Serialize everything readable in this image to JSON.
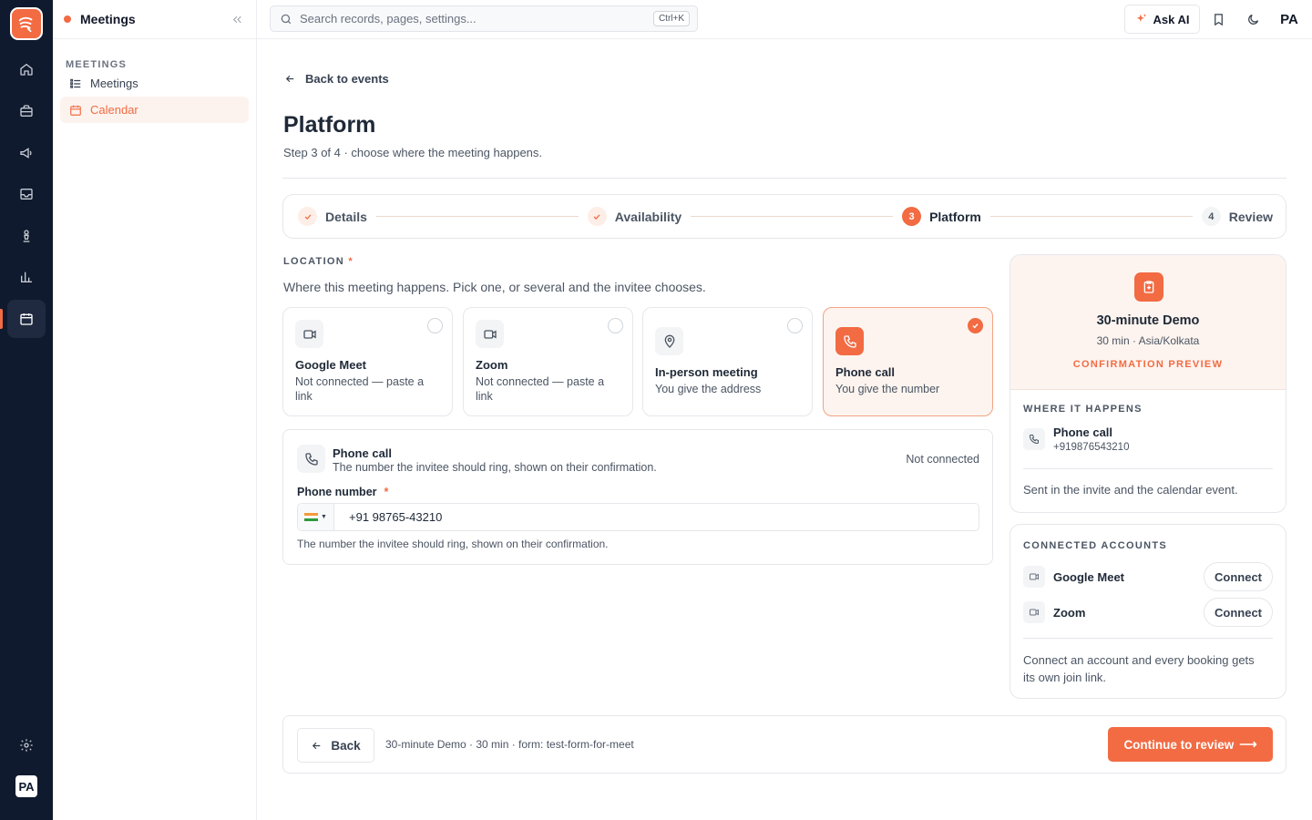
{
  "app": {
    "title": "Meetings"
  },
  "colors": {
    "accent": "#f26b43",
    "rail": "#0f1a2e"
  },
  "rail": {
    "icons": [
      "logo-icon",
      "home-icon",
      "briefcase-icon",
      "megaphone-icon",
      "inbox-icon",
      "chess-icon",
      "chart-icon",
      "calendar-icon",
      "settings-icon"
    ],
    "avatar": "PA"
  },
  "sidebar": {
    "title": "Meetings",
    "section": "MEETINGS",
    "items": [
      {
        "label": "Meetings",
        "icon": "list-icon"
      },
      {
        "label": "Calendar",
        "icon": "calendar-icon"
      }
    ]
  },
  "topbar": {
    "search_placeholder": "Search records, pages, settings...",
    "shortcut": "Ctrl+K",
    "ask_ai": "Ask AI",
    "avatar": "PA"
  },
  "main": {
    "back_link": "Back to events",
    "title": "Platform",
    "subtitle": "Step 3 of 4 · choose where the meeting happens."
  },
  "stepper": {
    "steps": [
      {
        "label": "Details",
        "status": "done",
        "marker": ""
      },
      {
        "label": "Availability",
        "status": "done",
        "marker": ""
      },
      {
        "label": "Platform",
        "status": "current",
        "marker": "3"
      },
      {
        "label": "Review",
        "status": "todo",
        "marker": "4"
      }
    ]
  },
  "location": {
    "label": "LOCATION",
    "required_mark": "*",
    "help": "Where this meeting happens. Pick one, or several and the invitee chooses.",
    "options": [
      {
        "name": "Google Meet",
        "desc": "Not connected — paste a link",
        "icon": "video-icon",
        "selected": false
      },
      {
        "name": "Zoom",
        "desc": "Not connected — paste a link",
        "icon": "video-icon",
        "selected": false
      },
      {
        "name": "In-person meeting",
        "desc": "You give the address",
        "icon": "map-pin-icon",
        "selected": false
      },
      {
        "name": "Phone call",
        "desc": "You give the number",
        "icon": "phone-icon",
        "selected": true
      }
    ]
  },
  "phone": {
    "title": "Phone call",
    "desc": "The number the invitee should ring, shown on their confirmation.",
    "status": "Not connected",
    "field_label": "Phone number",
    "required_mark": "*",
    "country": "IN",
    "value": "+91 98765-43210",
    "hint": "The number the invitee should ring, shown on their confirmation."
  },
  "preview": {
    "title": "30-minute Demo",
    "meta": "30 min · Asia/Kolkata",
    "tag": "CONFIRMATION PREVIEW",
    "section": "WHERE IT HAPPENS",
    "where_name": "Phone call",
    "where_number": "+919876543210",
    "note": "Sent in the invite and the calendar event."
  },
  "accounts": {
    "title": "CONNECTED ACCOUNTS",
    "items": [
      {
        "name": "Google Meet",
        "button": "Connect"
      },
      {
        "name": "Zoom",
        "button": "Connect"
      }
    ],
    "note": "Connect an account and every booking gets its own join link."
  },
  "footer": {
    "back": "Back",
    "summary": "30-minute Demo · 30 min · form: test-form-for-meet",
    "continue": "Continue to review",
    "continue_arrow": "⟶"
  }
}
